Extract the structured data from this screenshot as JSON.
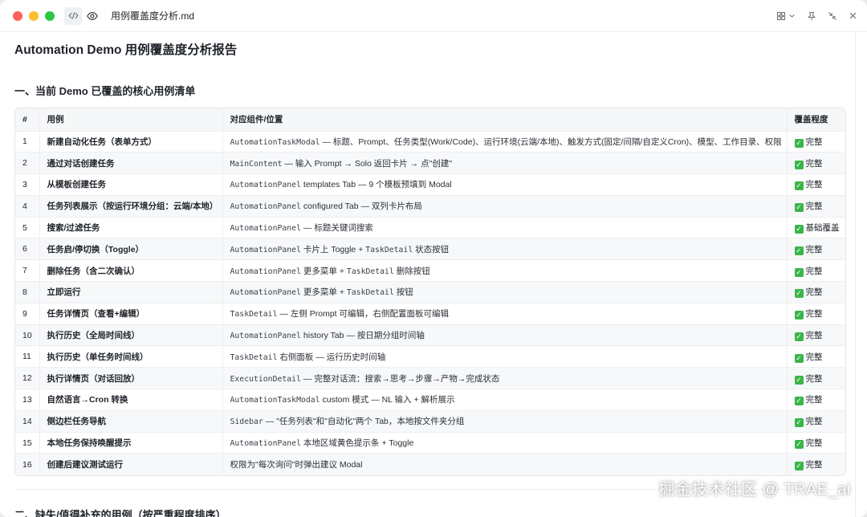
{
  "window": {
    "filename": "用例覆盖度分析.md"
  },
  "doc": {
    "title": "Automation Demo 用例覆盖度分析报告",
    "section1": "一、当前 Demo 已覆盖的核心用例清单",
    "section2": "二、缺失/值得补充的用例（按严重程度排序）"
  },
  "table": {
    "headers": [
      "#",
      "用例",
      "对应组件/位置",
      "覆盖程度"
    ],
    "rows": [
      {
        "num": "1",
        "case": "新建自动化任务（表单方式）",
        "code": "AutomationTaskModal",
        "desc": " — 标题、Prompt、任务类型(Work/Code)、运行环境(云端/本地)、触发方式(固定/间隔/自定义Cron)、模型、工作目录、权限",
        "status": "完整"
      },
      {
        "num": "2",
        "case": "通过对话创建任务",
        "code": "MainContent",
        "desc": " — 输入 Prompt → Solo 返回卡片 → 点\"创建\"",
        "status": "完整"
      },
      {
        "num": "3",
        "case": "从模板创建任务",
        "code": "AutomationPanel",
        "desc": " templates Tab — 9 个模板预填到 Modal",
        "status": "完整"
      },
      {
        "num": "4",
        "case": "任务列表展示（按运行环境分组：云端/本地）",
        "code": "AutomationPanel",
        "desc": " configured Tab — 双列卡片布局",
        "status": "完整"
      },
      {
        "num": "5",
        "case": "搜索/过滤任务",
        "code": "AutomationPanel",
        "desc": " — 标题关键词搜索",
        "status": "基础覆盖"
      },
      {
        "num": "6",
        "case": "任务启/停切换（Toggle）",
        "code": "AutomationPanel",
        "desc": " 卡片上 Toggle + ",
        "code2": "TaskDetail",
        "desc2": " 状态按钮",
        "status": "完整"
      },
      {
        "num": "7",
        "case": "删除任务（含二次确认）",
        "code": "AutomationPanel",
        "desc": " 更多菜单 + ",
        "code2": "TaskDetail",
        "desc2": " 删除按钮",
        "status": "完整"
      },
      {
        "num": "8",
        "case": "立即运行",
        "code": "AutomationPanel",
        "desc": " 更多菜单 + ",
        "code2": "TaskDetail",
        "desc2": " 按钮",
        "status": "完整"
      },
      {
        "num": "9",
        "case": "任务详情页（查看+编辑）",
        "code": "TaskDetail",
        "desc": " — 左侧 Prompt 可编辑，右侧配置面板可编辑",
        "status": "完整"
      },
      {
        "num": "10",
        "case": "执行历史（全局时间线）",
        "code": "AutomationPanel",
        "desc": " history Tab — 按日期分组时间轴",
        "status": "完整"
      },
      {
        "num": "11",
        "case": "执行历史（单任务时间线）",
        "code": "TaskDetail",
        "desc": " 右侧面板 — 运行历史时间轴",
        "status": "完整"
      },
      {
        "num": "12",
        "case": "执行详情页（对话回放）",
        "code": "ExecutionDetail",
        "desc": " — 完整对话流：搜索→思考→步骤→产物→完成状态",
        "status": "完整"
      },
      {
        "num": "13",
        "case": "自然语言→Cron 转换",
        "code": "AutomationTaskModal",
        "desc": " custom 模式 — NL 输入 + 解析展示",
        "status": "完整"
      },
      {
        "num": "14",
        "case": "侧边栏任务导航",
        "code": "Sidebar",
        "desc": " — \"任务列表\"和\"自动化\"两个 Tab，本地按文件夹分组",
        "status": "完整"
      },
      {
        "num": "15",
        "case": "本地任务保持唤醒提示",
        "code": "AutomationPanel",
        "desc": " 本地区域黄色提示条 + Toggle",
        "status": "完整"
      },
      {
        "num": "16",
        "case": "创建后建议测试运行",
        "code": "",
        "desc": "权限为\"每次询问\"时弹出建议 Modal",
        "status": "完整"
      }
    ]
  },
  "watermark": "掘金技术社区 @ TRAE_ai"
}
